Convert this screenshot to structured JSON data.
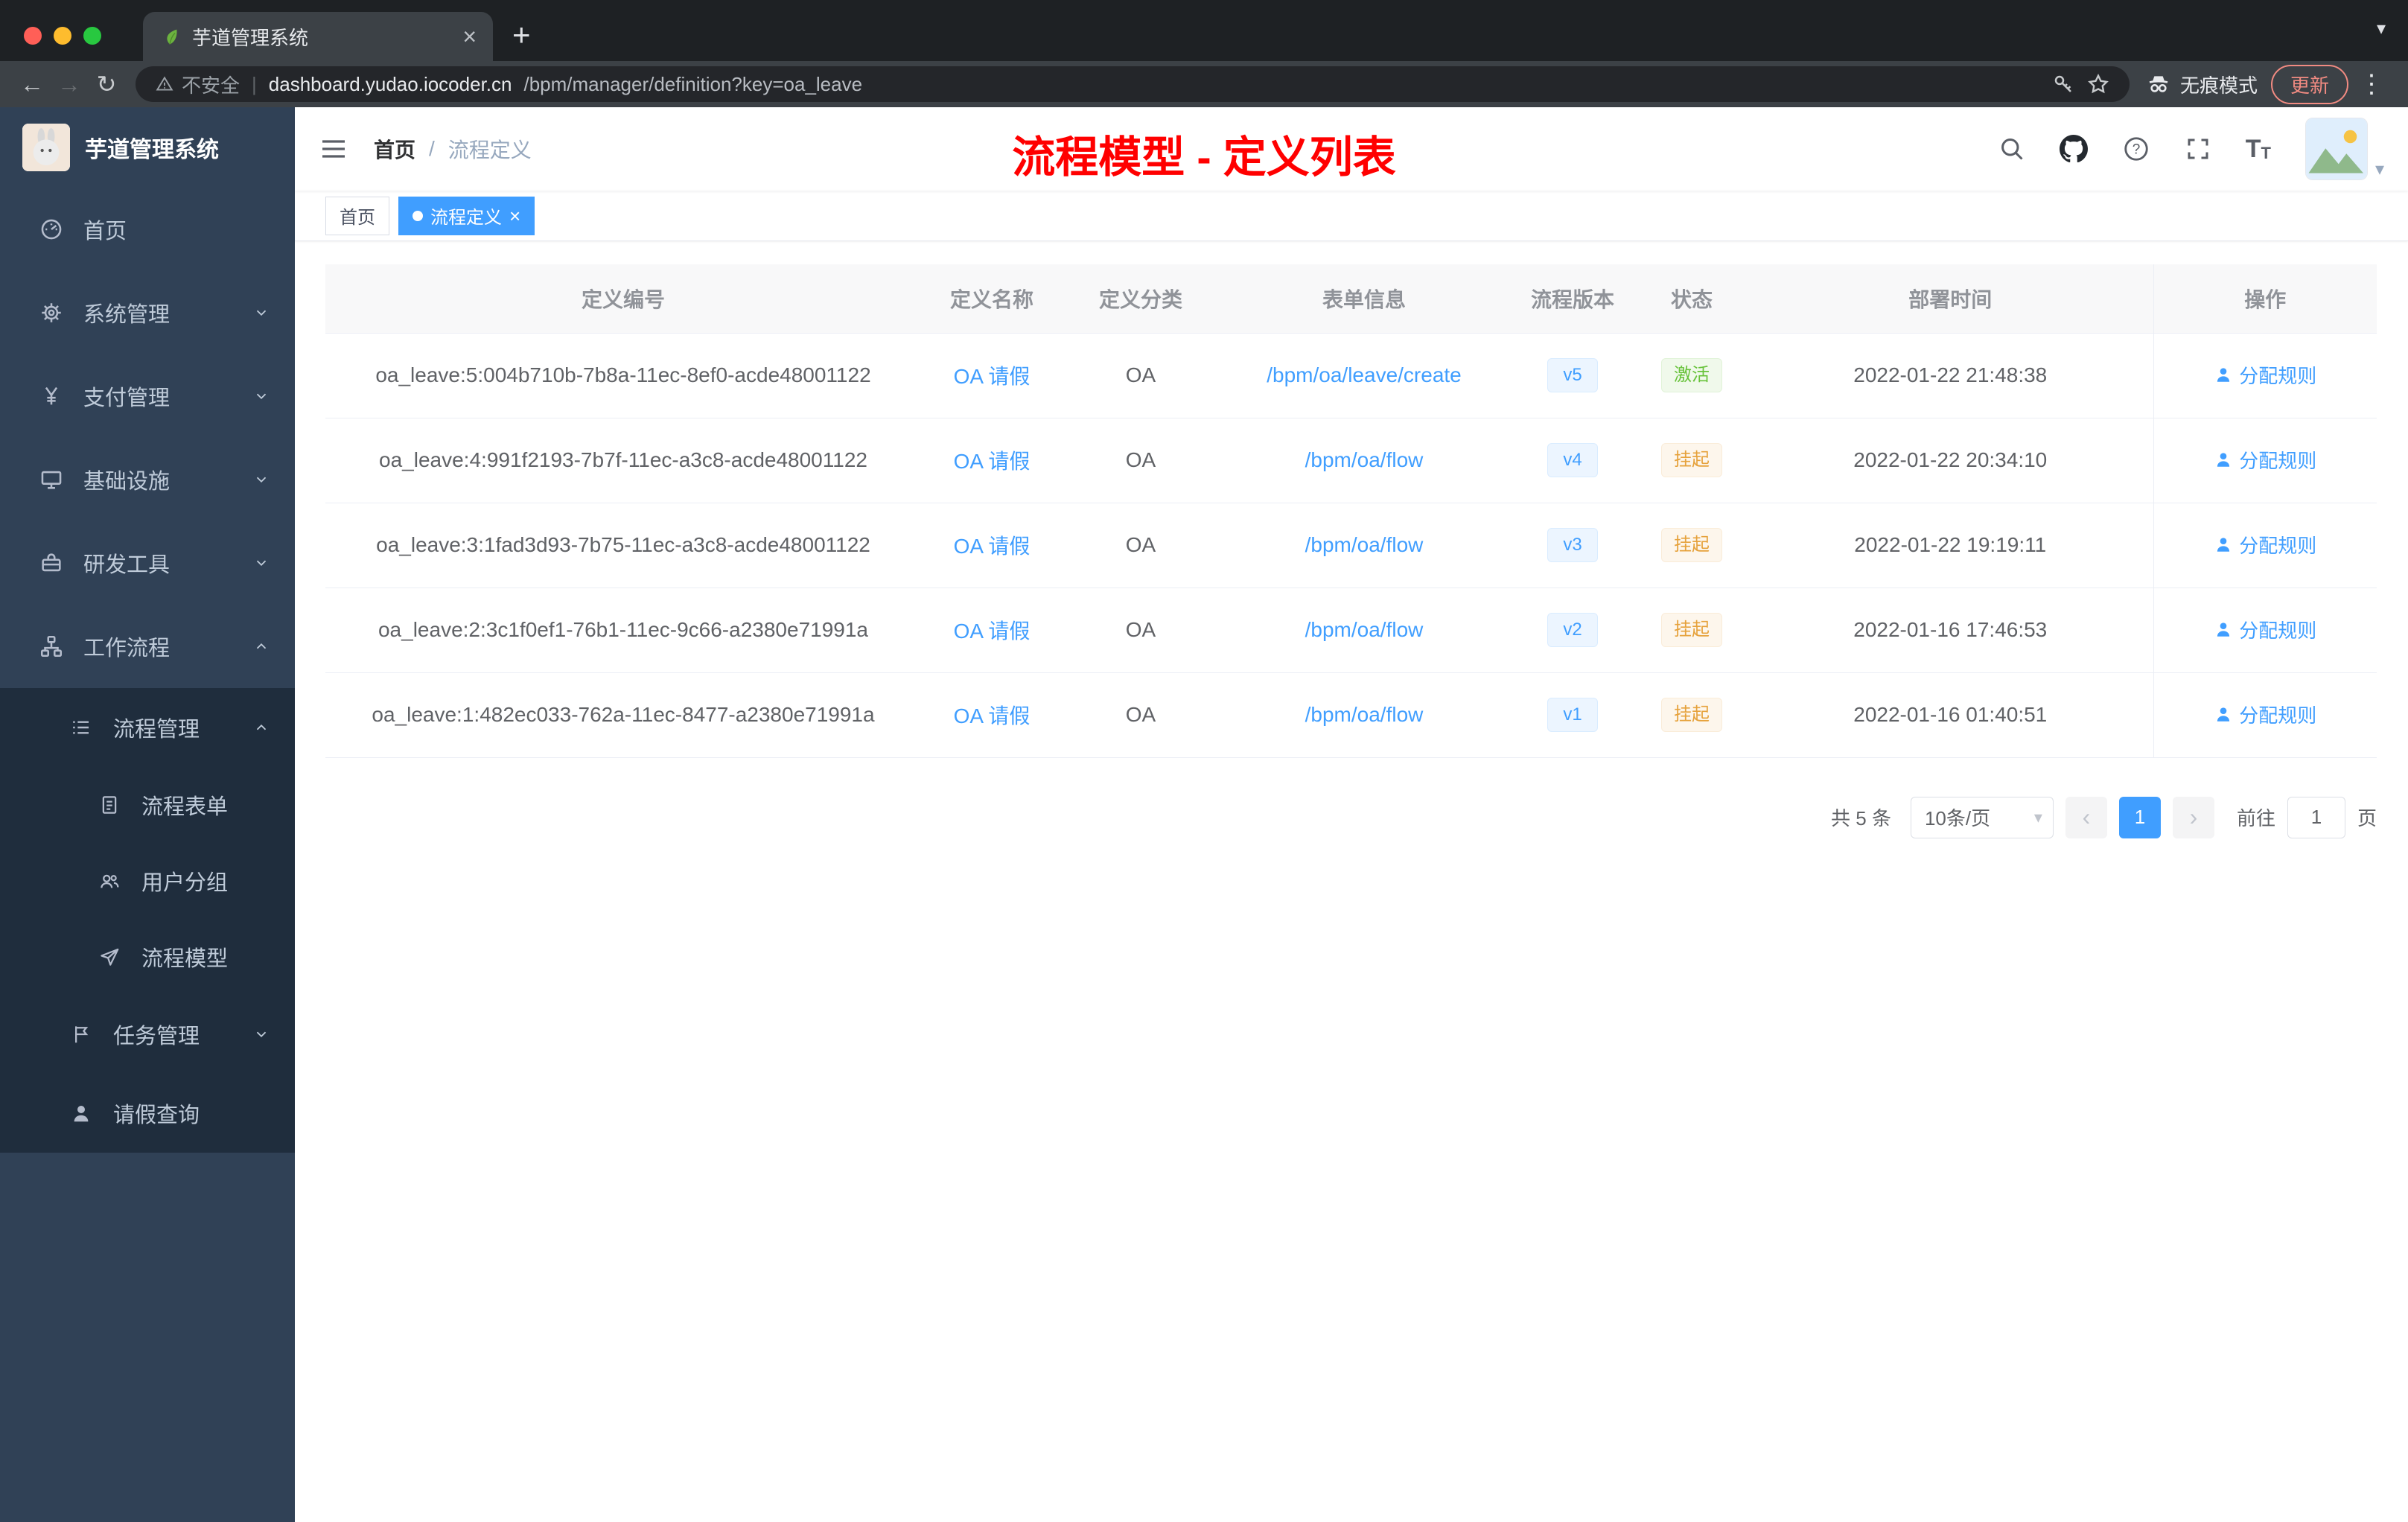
{
  "browser": {
    "tab_title": "芋道管理系统",
    "security_label": "不安全",
    "url_domain": "dashboard.yudao.iocoder.cn",
    "url_path": "/bpm/manager/definition?key=oa_leave",
    "incognito_label": "无痕模式",
    "update_label": "更新"
  },
  "sidebar": {
    "logo_title": "芋道管理系统",
    "items": [
      {
        "label": "首页"
      },
      {
        "label": "系统管理"
      },
      {
        "label": "支付管理"
      },
      {
        "label": "基础设施"
      },
      {
        "label": "研发工具"
      },
      {
        "label": "工作流程"
      },
      {
        "label": "流程管理"
      },
      {
        "label": "流程表单"
      },
      {
        "label": "用户分组"
      },
      {
        "label": "流程模型"
      },
      {
        "label": "任务管理"
      },
      {
        "label": "请假查询"
      }
    ]
  },
  "header": {
    "breadcrumb_home": "首页",
    "breadcrumb_separator": "/",
    "breadcrumb_current": "流程定义",
    "overlay_title": "流程模型 - 定义列表"
  },
  "tags": [
    {
      "label": "首页"
    },
    {
      "label": "流程定义"
    }
  ],
  "table": {
    "columns": [
      "定义编号",
      "定义名称",
      "定义分类",
      "表单信息",
      "流程版本",
      "状态",
      "部署时间",
      "操作"
    ],
    "rows": [
      {
        "id": "oa_leave:5:004b710b-7b8a-11ec-8ef0-acde48001122",
        "name": "OA 请假",
        "category": "OA",
        "form": "/bpm/oa/leave/create",
        "version": "v5",
        "status": "激活",
        "time": "2022-01-22 21:48:38",
        "action": "分配规则"
      },
      {
        "id": "oa_leave:4:991f2193-7b7f-11ec-a3c8-acde48001122",
        "name": "OA 请假",
        "category": "OA",
        "form": "/bpm/oa/flow",
        "version": "v4",
        "status": "挂起",
        "time": "2022-01-22 20:34:10",
        "action": "分配规则"
      },
      {
        "id": "oa_leave:3:1fad3d93-7b75-11ec-a3c8-acde48001122",
        "name": "OA 请假",
        "category": "OA",
        "form": "/bpm/oa/flow",
        "version": "v3",
        "status": "挂起",
        "time": "2022-01-22 19:19:11",
        "action": "分配规则"
      },
      {
        "id": "oa_leave:2:3c1f0ef1-76b1-11ec-9c66-a2380e71991a",
        "name": "OA 请假",
        "category": "OA",
        "form": "/bpm/oa/flow",
        "version": "v2",
        "status": "挂起",
        "time": "2022-01-16 17:46:53",
        "action": "分配规则"
      },
      {
        "id": "oa_leave:1:482ec033-762a-11ec-8477-a2380e71991a",
        "name": "OA 请假",
        "category": "OA",
        "form": "/bpm/oa/flow",
        "version": "v1",
        "status": "挂起",
        "time": "2022-01-16 01:40:51",
        "action": "分配规则"
      }
    ]
  },
  "pagination": {
    "total": "共 5 条",
    "page_size": "10条/页",
    "current_page": "1",
    "goto_label": "前往",
    "goto_value": "1",
    "page_unit": "页"
  },
  "icons": {
    "back": "←",
    "forward": "→",
    "reload": "↻",
    "divider": "|",
    "kebab": "⋮",
    "new_tab": "+",
    "tab_close": "×",
    "strip_caret": "▾",
    "caret_down": "▾",
    "prev": "‹",
    "next": "›",
    "help": "?",
    "text_big": "T",
    "text_small": "T",
    "tag_close": "×"
  }
}
